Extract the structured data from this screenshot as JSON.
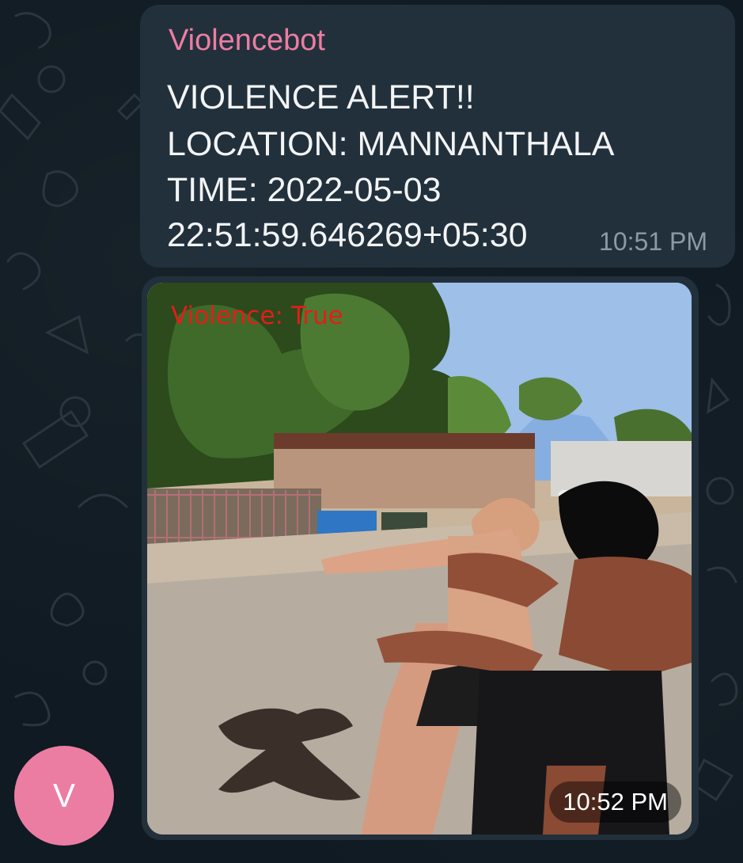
{
  "message": {
    "sender": "Violencebot",
    "lines": [
      "VIOLENCE ALERT!!",
      "LOCATION: MANNANTHALA",
      "TIME: 2022-05-03",
      "22:51:59.646269+05:30"
    ],
    "time": "10:51 PM"
  },
  "media": {
    "overlay_label": "Violence: True",
    "time": "10:52 PM"
  },
  "avatar": {
    "initial": "V",
    "color": "#ec7da2"
  },
  "colors": {
    "chat_background": "#0f1a22",
    "bubble": "#22303c",
    "sender_name": "#ee7da1",
    "overlay_label": "#e41d18"
  }
}
